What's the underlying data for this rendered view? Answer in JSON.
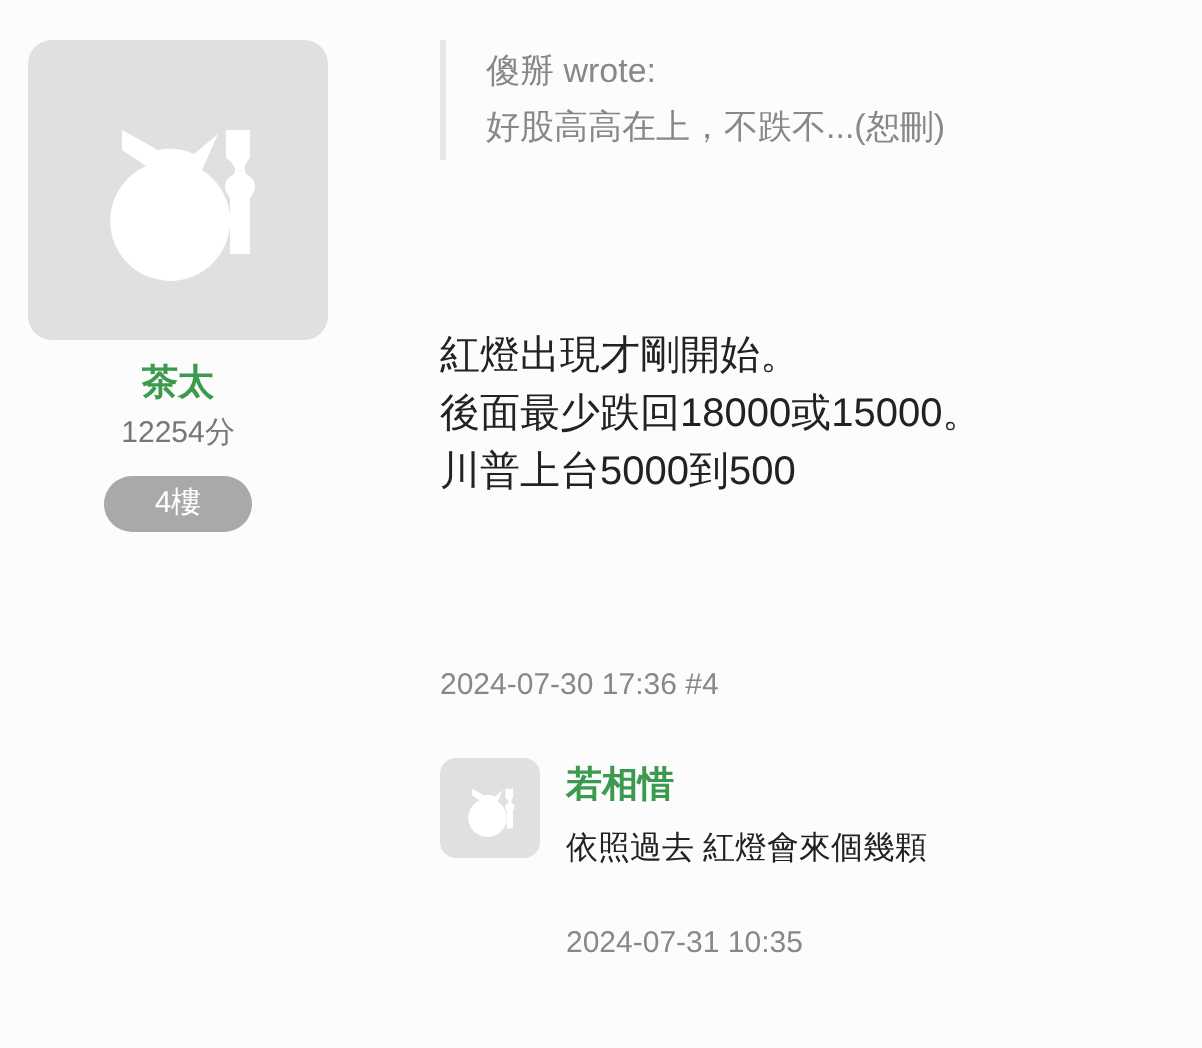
{
  "post": {
    "author": "茶太",
    "score": "12254分",
    "floor": "4樓",
    "quote": {
      "header": "傻掰 wrote:",
      "text": "好股高高在上，不跌不...(恕刪)"
    },
    "body": [
      "紅燈出現才剛開始。",
      "後面最少跌回18000或15000。",
      "川普上台5000到500"
    ],
    "timestamp": "2024-07-30 17:36 #4"
  },
  "replies": [
    {
      "author": "若相惜",
      "text": "依照過去 紅燈會來個幾顆",
      "timestamp": "2024-07-31 10:35"
    }
  ]
}
